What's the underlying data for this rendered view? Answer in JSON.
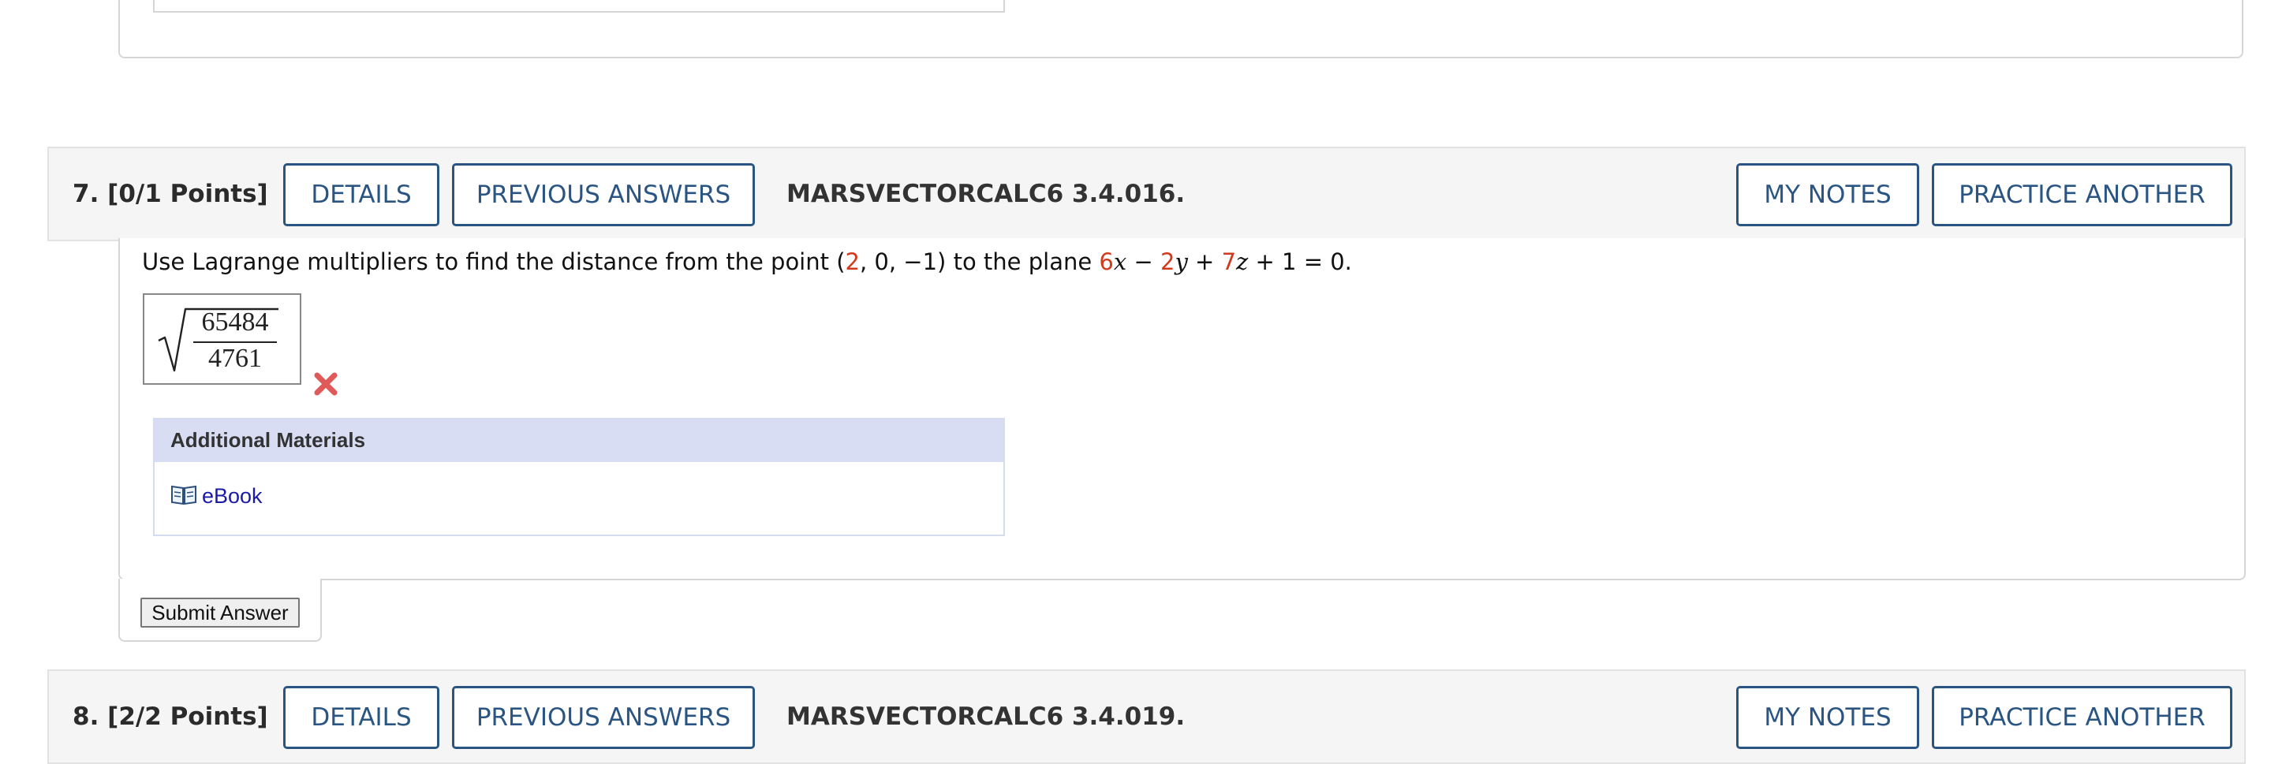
{
  "question7": {
    "number": "7.",
    "points": "[0/1 Points]",
    "details_label": "DETAILS",
    "previous_answers_label": "PREVIOUS ANSWERS",
    "code": "MARSVECTORCALC6 3.4.016.",
    "my_notes_label": "MY NOTES",
    "practice_another_label": "PRACTICE ANOTHER",
    "prompt": {
      "text_before": "Use Lagrange multipliers to find the distance from the point (",
      "point_x": "2",
      "point_rest": ", 0, −1) to the plane ",
      "coef_x": "6",
      "var_x": "x",
      "minus": " − ",
      "coef_y": "2",
      "var_y": "y",
      "plus": " + ",
      "coef_z": "7",
      "var_z": "z",
      "tail": " + 1 = 0."
    },
    "answer": {
      "numerator": "65484",
      "denominator": "4761"
    },
    "result_icon": "red-x-icon",
    "additional_materials_title": "Additional Materials",
    "ebook_icon": "book-icon",
    "ebook_label": "eBook",
    "submit_label": "Submit Answer"
  },
  "question8": {
    "number": "8.",
    "points": "[2/2 Points]",
    "details_label": "DETAILS",
    "previous_answers_label": "PREVIOUS ANSWERS",
    "code": "MARSVECTORCALC6 3.4.019.",
    "my_notes_label": "MY NOTES",
    "practice_another_label": "PRACTICE ANOTHER"
  },
  "colors": {
    "button_border": "#2a5583",
    "highlight_red": "#d23a1e",
    "wrong_red": "#e05a5a",
    "materials_header_bg": "#d8ddf3",
    "link_blue": "#1a1aa8"
  }
}
